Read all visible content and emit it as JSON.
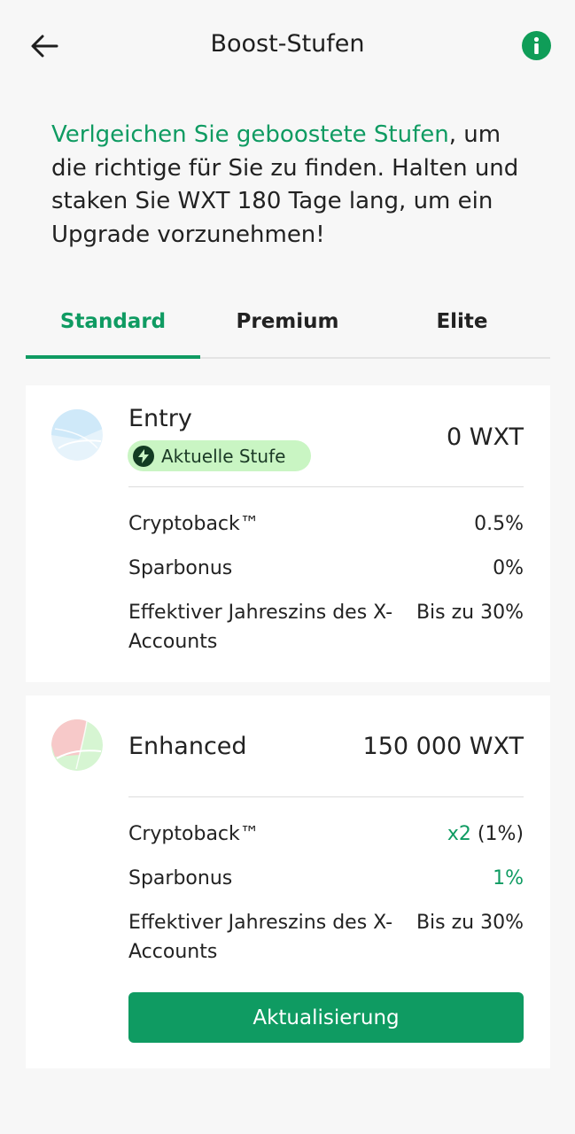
{
  "header": {
    "title": "Boost-Stufen"
  },
  "intro": {
    "link_text": "Verlgeichen Sie geboostete Stufen",
    "text": ", um die richtige für Sie zu finden. Halten und staken Sie WXT 180 Tage lang, um ein Upgrade vorzunehmen!"
  },
  "tabs": [
    {
      "label": "Standard",
      "active": true
    },
    {
      "label": "Premium",
      "active": false
    },
    {
      "label": "Elite",
      "active": false
    }
  ],
  "tiers": [
    {
      "name": "Entry",
      "amount": "0 WXT",
      "badge": "Aktuelle Stufe",
      "rows": [
        {
          "label": "Cryptoback™",
          "value": "0.5%"
        },
        {
          "label": "Sparbonus",
          "value": "0%"
        },
        {
          "label": "Effektiver Jahreszins des X-Accounts",
          "value": "Bis zu 30%"
        }
      ]
    },
    {
      "name": "Enhanced",
      "amount": "150 000 WXT",
      "rows": [
        {
          "label": "Cryptoback™",
          "value_highlight": "x2",
          "value": " (1%)"
        },
        {
          "label": "Sparbonus",
          "value_highlight": "1%"
        },
        {
          "label": "Effektiver Jahreszins des X-Accounts",
          "value": "Bis zu 30%"
        }
      ],
      "button": "Aktualisierung"
    }
  ],
  "colors": {
    "accent": "#0f9b62",
    "badge_bg": "#c9f5c3",
    "background": "#f7f7f7"
  },
  "icons": [
    "back-arrow-icon",
    "info-icon",
    "lightning-icon",
    "tier-entry-icon",
    "tier-enhanced-icon"
  ]
}
